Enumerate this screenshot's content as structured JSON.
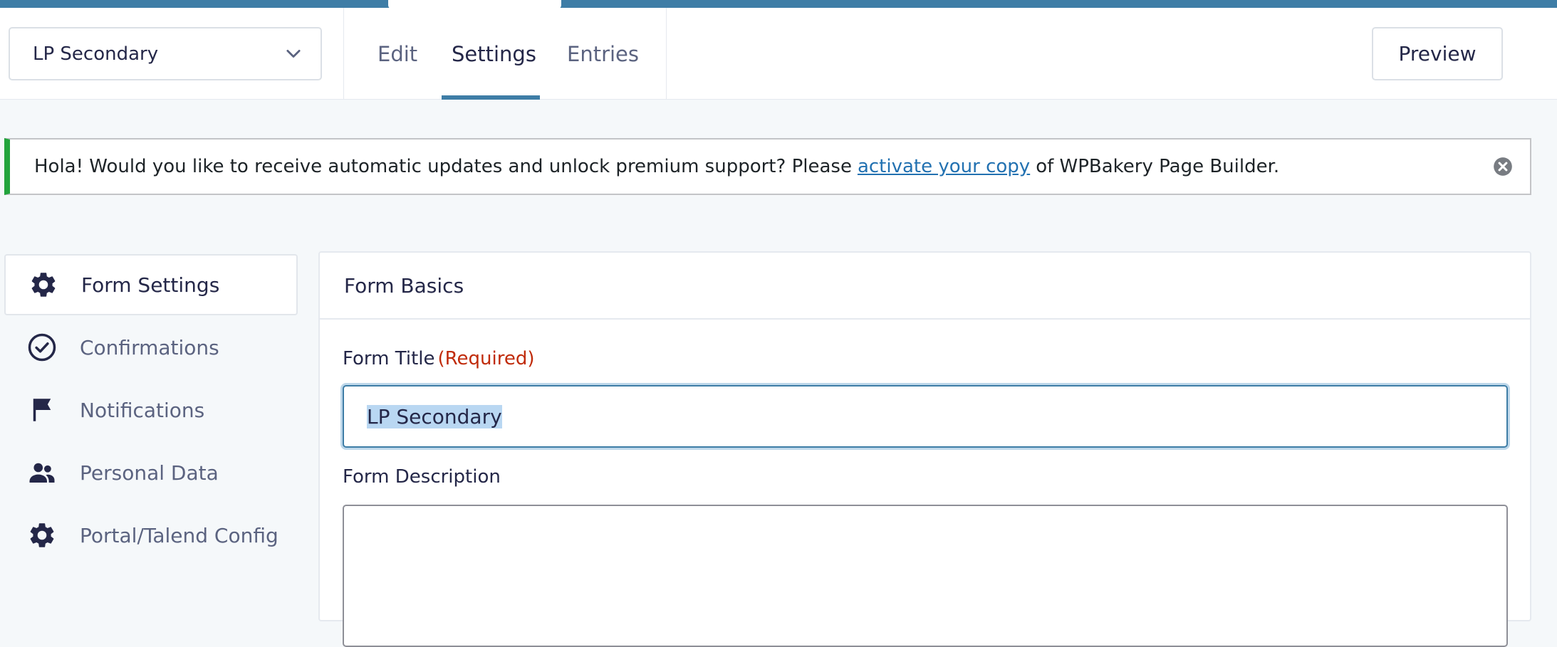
{
  "header": {
    "form_select_value": "LP Secondary",
    "tabs": [
      {
        "label": "Edit",
        "active": false
      },
      {
        "label": "Settings",
        "active": true
      },
      {
        "label": "Entries",
        "active": false
      }
    ],
    "preview_label": "Preview"
  },
  "notice": {
    "text_before": "Hola! Would you like to receive automatic updates and unlock premium support? Please",
    "link_text": "activate your copy",
    "text_after": "of WPBakery Page Builder."
  },
  "sidebar": {
    "items": [
      {
        "label": "Form Settings",
        "icon": "gear-icon",
        "active": true
      },
      {
        "label": "Confirmations",
        "icon": "check-circle-icon",
        "active": false
      },
      {
        "label": "Notifications",
        "icon": "flag-icon",
        "active": false
      },
      {
        "label": "Personal Data",
        "icon": "users-icon",
        "active": false
      },
      {
        "label": "Portal/Talend Config",
        "icon": "gear-icon",
        "active": false
      }
    ]
  },
  "panel": {
    "title": "Form Basics",
    "form_title_label": "Form Title",
    "required_text": "(Required)",
    "form_title_value": "LP Secondary",
    "form_description_label": "Form Description",
    "form_description_value": ""
  },
  "colors": {
    "accent": "#3e7da6",
    "notice_border": "#22a43c",
    "required": "#c02b0a",
    "link": "#2271b1"
  }
}
